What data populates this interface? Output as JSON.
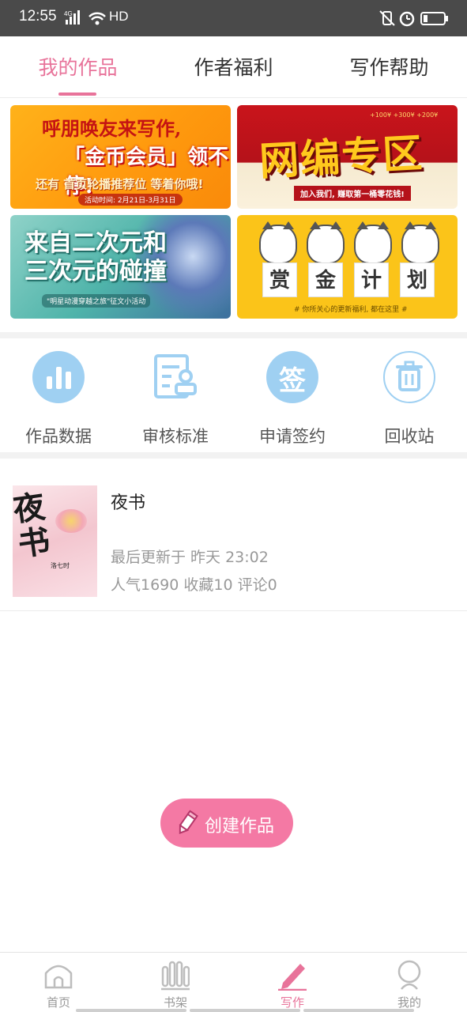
{
  "status_bar": {
    "time": "12:55",
    "network": "4G",
    "hd": "HD"
  },
  "top_tabs": [
    {
      "label": "我的作品",
      "active": true
    },
    {
      "label": "作者福利",
      "active": false
    },
    {
      "label": "写作帮助",
      "active": false
    }
  ],
  "banners": {
    "b1": {
      "line1": "呼朋唤友来写作,",
      "line2": "「金币会员」领不停!",
      "line3": "还有 首页轮播推荐位 等着你哦!",
      "foot": "活动时间: 2月21日-3月31日"
    },
    "b2": {
      "title": "网编专区",
      "sub": "加入我们, 赚取第一桶零花钱!",
      "coins": "+100¥  +300¥  +200¥"
    },
    "b3": {
      "title": "来自二次元和三次元的碰撞",
      "sub": "\"明星动漫穿越之旅\"征文小活动"
    },
    "b4": {
      "chars": [
        "赏",
        "金",
        "计",
        "划"
      ],
      "foot": "# 你所关心的更新福利, 都在这里 #"
    }
  },
  "actions": [
    {
      "label": "作品数据",
      "icon": "chart-icon"
    },
    {
      "label": "审核标准",
      "icon": "review-document-icon"
    },
    {
      "label": "申请签约",
      "icon": "sign-icon",
      "glyph": "签"
    },
    {
      "label": "回收站",
      "icon": "trash-icon"
    }
  ],
  "work": {
    "title": "夜书",
    "cover_title": "夜书",
    "cover_author": "洛七时",
    "updated": "最后更新于 昨天 23:02",
    "stats": "人气1690 收藏10 评论0"
  },
  "create_button": {
    "label": "创建作品"
  },
  "bottom_nav": [
    {
      "label": "首页",
      "icon": "home-icon",
      "active": false
    },
    {
      "label": "书架",
      "icon": "bookshelf-icon",
      "active": false
    },
    {
      "label": "写作",
      "icon": "pencil-icon",
      "active": true
    },
    {
      "label": "我的",
      "icon": "profile-icon",
      "active": false
    }
  ],
  "colors": {
    "accent": "#e8739a",
    "action_blue": "#9fd0f2",
    "create_button": "#f479a4"
  }
}
